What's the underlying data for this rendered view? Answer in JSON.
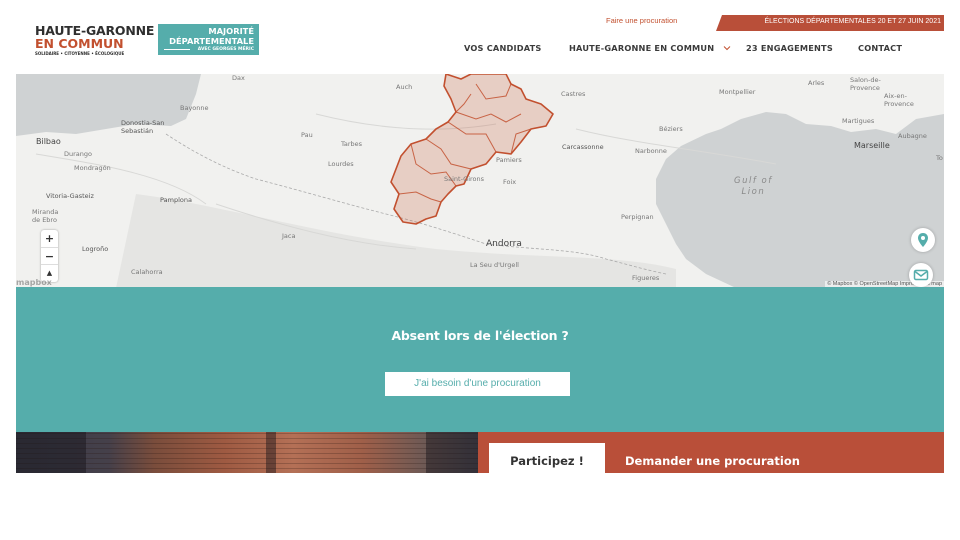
{
  "header": {
    "logo": {
      "line1": "HAUTE-GARONNE",
      "line2": "EN COMMUN",
      "tagline": "SOLIDAIRE • CITOYENNE • ÉCOLOGIQUE"
    },
    "badge": {
      "line1": "MAJORITÉ",
      "line2": "DÉPARTEMENTALE",
      "line3": "AVEC GEORGES MÉRIC"
    },
    "procuration_link": "Faire une procuration",
    "election_banner": "ÉLECTIONS DÉPARTEMENTALES 20 ET 27 JUIN 2021",
    "nav": [
      {
        "label": "VOS CANDIDATS"
      },
      {
        "label": "HAUTE-GARONNE EN COMMUN"
      },
      {
        "label": "23 ENGAGEMENTS"
      },
      {
        "label": "CONTACT"
      }
    ]
  },
  "map": {
    "labels": {
      "dax": "Dax",
      "auch": "Auch",
      "castres": "Castres",
      "montpellier": "Montpellier",
      "arles": "Arles",
      "salon": "Salon-de-\nProvence",
      "aix": "Aix-en-\nProvence",
      "bayonne": "Bayonne",
      "donostia": "Donostia-San\nSebastián",
      "bilbao": "Bilbao",
      "pau": "Pau",
      "tarbes": "Tarbes",
      "lourdes": "Lourdes",
      "durango": "Durango",
      "mondragon": "Mondragón",
      "carcassonne": "Carcassonne",
      "narbonne": "Narbonne",
      "beziers": "Béziers",
      "pamiers": "Pamiers",
      "saint_girons": "Saint-Girons",
      "foix": "Foix",
      "marseille": "Marseille",
      "martigues": "Martigues",
      "aubagne": "Aubagne",
      "vitoria": "Vitoria-Gasteiz",
      "pamplona": "Pamplona",
      "miranda": "Miranda\nde Ebro",
      "gulf": "Gulf of\nLion",
      "perpignan": "Perpignan",
      "jaca": "Jaca",
      "andorra": "Andorra",
      "seu": "La Seu d'Urgell",
      "figueres": "Figueres",
      "logrono": "Logroño",
      "calahorra": "Calahorra",
      "toulon": "To"
    },
    "zoom_in": "+",
    "zoom_out": "−",
    "compass": "▲",
    "mapbox_logo": "mapbox",
    "attribution": "© Mapbox © OpenStreetMap Improve this map"
  },
  "absent": {
    "title": "Absent lors de l'élection ?",
    "cta": "J'ai besoin d'une procuration"
  },
  "bottom": {
    "tab_active": "Participez !",
    "tab_link": "Demander une procuration"
  },
  "colors": {
    "teal": "#55adab",
    "rust": "#b94f39",
    "brand_orange": "#c2502f"
  },
  "icons": {
    "pin": "map-pin-icon",
    "mail": "mail-icon",
    "chevron": "chevron-down-icon"
  }
}
